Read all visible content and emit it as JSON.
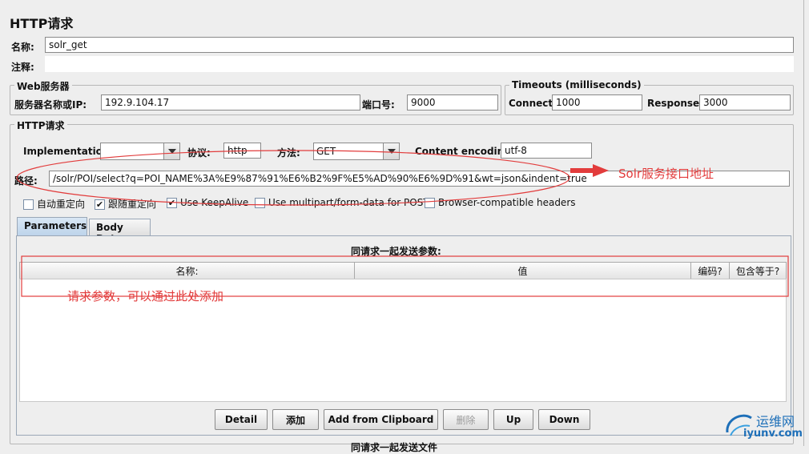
{
  "window": {
    "title": "HTTP请求"
  },
  "name_row": {
    "label": "名称:",
    "value": "solr_get"
  },
  "comment_row": {
    "label": "注释:",
    "value": ""
  },
  "web_server": {
    "legend": "Web服务器",
    "server_label": "服务器名称或IP:",
    "server_value": "192.9.104.17",
    "port_label": "端口号:",
    "port_value": "9000"
  },
  "timeouts": {
    "legend": "Timeouts (milliseconds)",
    "connect_label": "Connect:",
    "connect_value": "1000",
    "response_label": "Response:",
    "response_value": "3000"
  },
  "http_request": {
    "legend": "HTTP请求",
    "implementation_label": "Implementation:",
    "implementation_value": "",
    "protocol_label": "协议:",
    "protocol_value": "http",
    "method_label": "方法:",
    "method_value": "GET",
    "encoding_label": "Content encoding:",
    "encoding_value": "utf-8",
    "path_label": "路径:",
    "path_value": "/solr/POI/select?q=POI_NAME%3A%E9%87%91%E6%B2%9F%E5%AD%90%E6%9D%91&wt=json&indent=true"
  },
  "options": [
    {
      "label": "自动重定向",
      "checked": false
    },
    {
      "label": "跟随重定向",
      "checked": true
    },
    {
      "label": "Use KeepAlive",
      "checked": true
    },
    {
      "label": "Use multipart/form-data for POST",
      "checked": false
    },
    {
      "label": "Browser-compatible headers",
      "checked": false
    }
  ],
  "tabs": [
    {
      "label": "Parameters",
      "active": true
    },
    {
      "label": "Body Data",
      "active": false
    }
  ],
  "params": {
    "caption": "同请求一起发送参数:",
    "columns": [
      "名称:",
      "值",
      "编码?",
      "包含等于?"
    ]
  },
  "buttons": {
    "detail": "Detail",
    "add": "添加",
    "add_clipboard": "Add from Clipboard",
    "delete": "删除",
    "up": "Up",
    "down": "Down"
  },
  "next_section_caption": "同请求一起发送文件",
  "annotations": {
    "solr_label": "Solr服务接口地址",
    "params_label": "请求参数，可以通过此处添加",
    "color": "#e23c3c"
  },
  "watermark": {
    "text": "运维网",
    "sub": "iyunv.com"
  }
}
